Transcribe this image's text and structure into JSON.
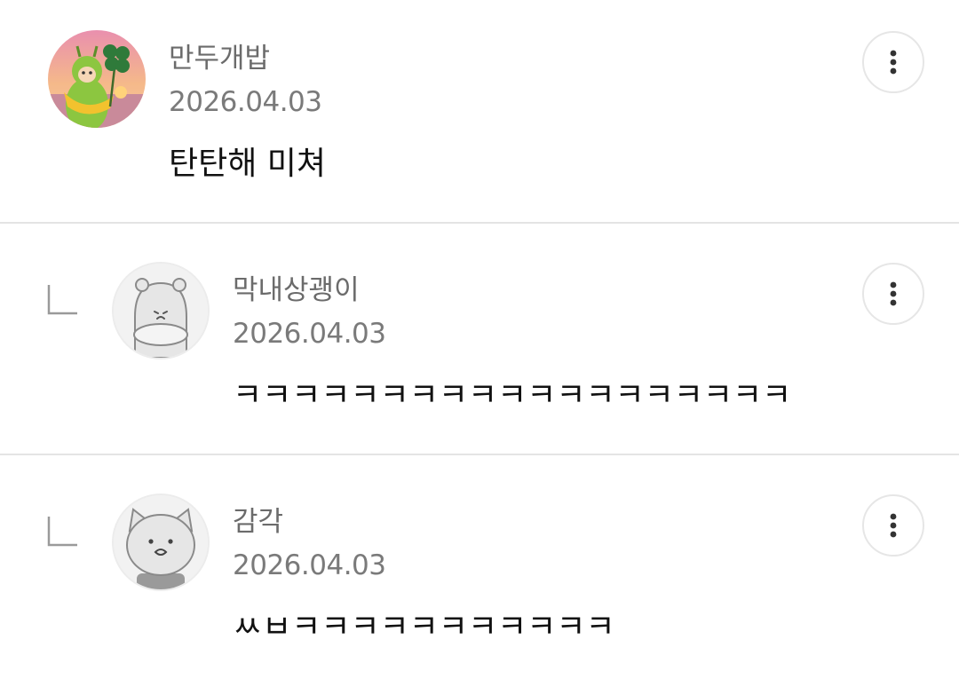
{
  "comments": [
    {
      "author": "만두개밥",
      "date": "2026.04.03",
      "text": "탄탄해 미쳐",
      "avatar": "teletubby-clover-avatar",
      "is_reply": false
    },
    {
      "author": "막내상괭이",
      "date": "2026.04.03",
      "text": "ㅋㅋㅋㅋㅋㅋㅋㅋㅋㅋㅋㅋㅋㅋㅋㅋㅋㅋㅋ",
      "avatar": "hamster-default-avatar",
      "is_reply": true
    },
    {
      "author": "감각",
      "date": "2026.04.03",
      "text": "ㅆㅂㅋㅋㅋㅋㅋㅋㅋㅋㅋㅋㅋ",
      "avatar": "cat-default-avatar",
      "is_reply": true
    }
  ],
  "icons": {
    "more": "more-vertical-icon",
    "reply": "reply-arrow-icon"
  },
  "colors": {
    "divider": "#e4e4e4",
    "author": "#6b6b6b",
    "text": "#111111",
    "avatar_bg": "#f2f2f2"
  }
}
